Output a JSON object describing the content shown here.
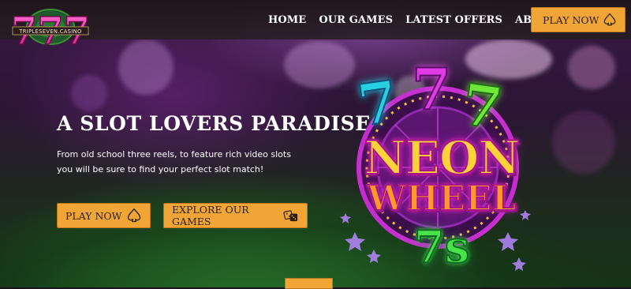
{
  "brand": {
    "logo_number": "777",
    "logo_subtext": "TRIPLESEVEN.CASINO"
  },
  "nav": {
    "items": [
      {
        "label": "HOME"
      },
      {
        "label": "OUR GAMES"
      },
      {
        "label": "LATEST OFFERS"
      },
      {
        "label": "ABOUT US"
      }
    ],
    "cta_label": "PLAY NOW",
    "cta_icon": "spade-icon"
  },
  "hero": {
    "title": "A SLOT LOVERS PARADISE",
    "subtitle": "From old school three reels, to feature rich video slots you will be sure to find your perfect slot match!",
    "play_label": "PLAY NOW",
    "play_icon": "spade-icon",
    "explore_label": "EXPLORE OUR GAMES",
    "explore_icon": "dice-icon"
  },
  "game": {
    "sevens": "777",
    "line1": "NEON",
    "line2": "WHEEL",
    "line3": "7s"
  },
  "colors": {
    "accent": "#f0a536",
    "accent_border": "#b8761a",
    "nav_bg": "#1c1618",
    "text": "#ffffff"
  }
}
